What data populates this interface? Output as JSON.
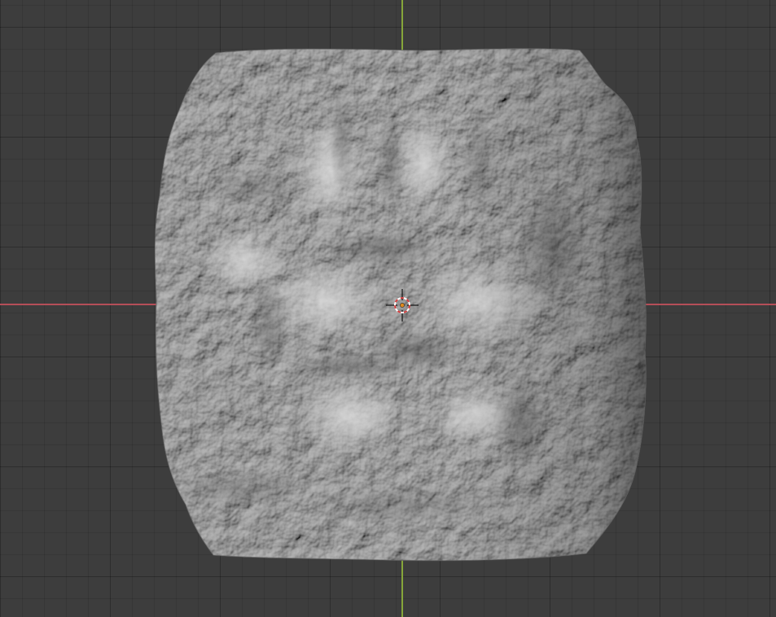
{
  "viewport": {
    "background_color": "#3d3d3d",
    "grid_line_color": "#353535"
  },
  "axes": {
    "x_axis_color": "#b54e58",
    "y_axis_color": "#86a63a"
  },
  "scene": {
    "object": "terrain-mesh",
    "object_shading": "solid-gray",
    "mesh_color": "#b9b9b9",
    "shadow_color": "#555555",
    "highlight_color": "#e2e2e2"
  },
  "origin_marker": {
    "icon": "3d-cursor-icon",
    "ring_color_a": "#d23c3c",
    "ring_color_b": "#ffffff",
    "center_dot_color": "#e08a1e"
  }
}
